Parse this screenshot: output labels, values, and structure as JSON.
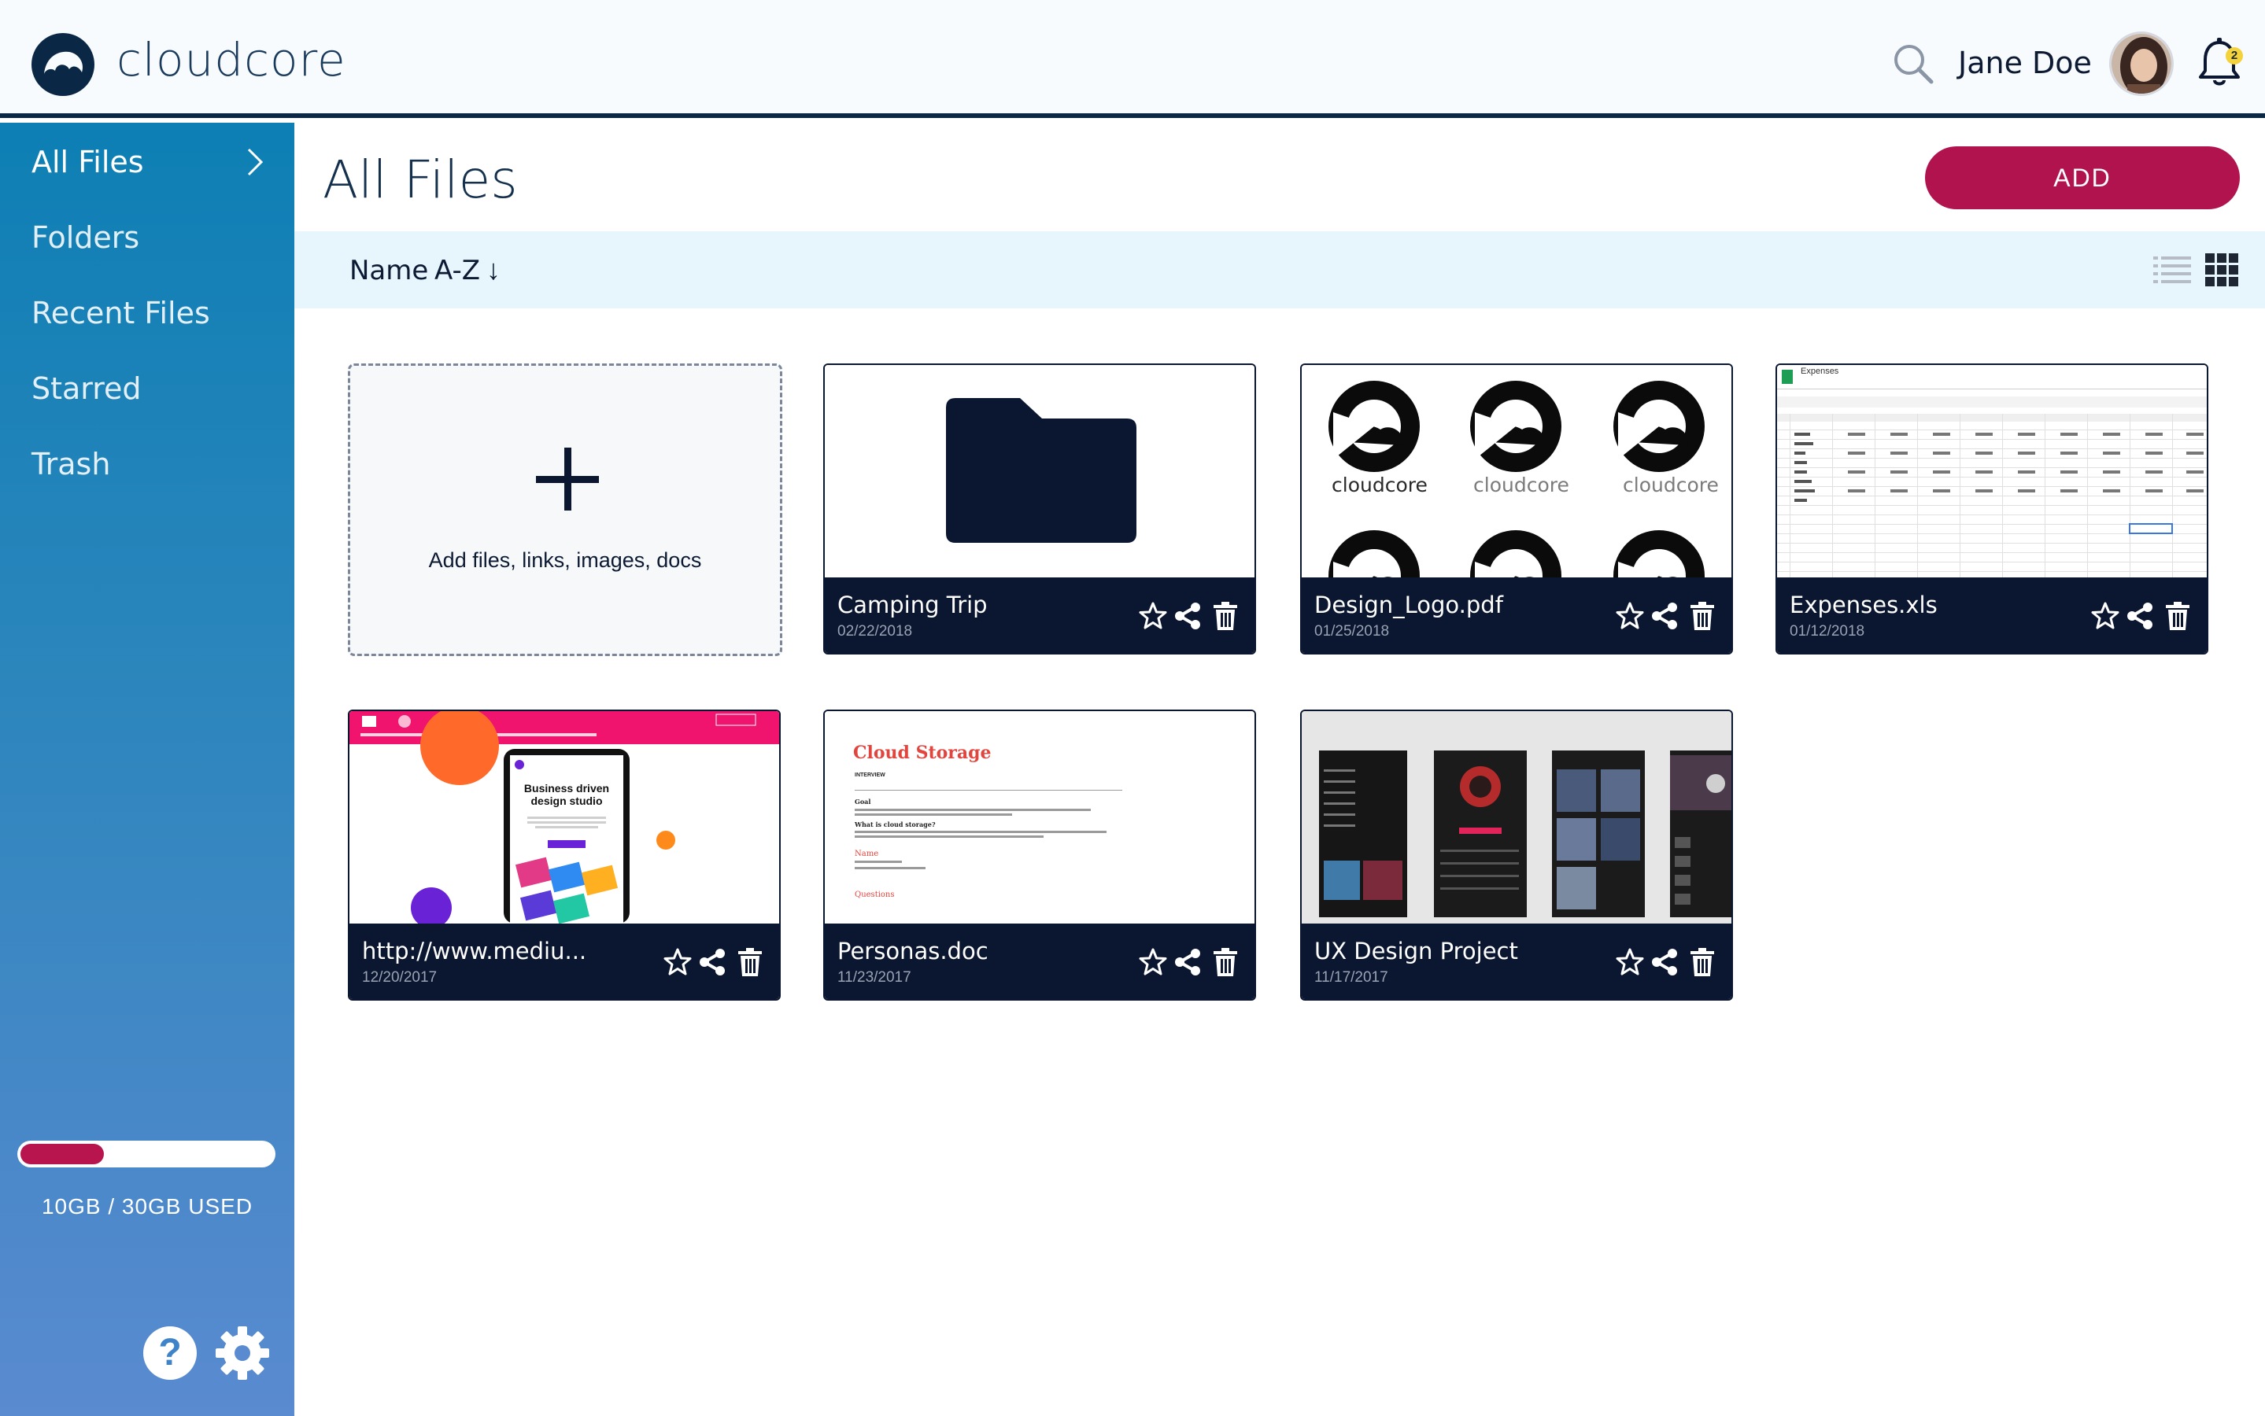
{
  "app": {
    "name": "cloudcore",
    "brand_color": "#0b2746",
    "accent_color": "#b0134e"
  },
  "header": {
    "user_name": "Jane Doe",
    "notification_count": "2"
  },
  "sidebar": {
    "items": [
      {
        "label": "All Files",
        "active": true
      },
      {
        "label": "Folders"
      },
      {
        "label": "Recent Files"
      },
      {
        "label": "Starred"
      },
      {
        "label": "Trash"
      }
    ],
    "storage_text": "10GB / 30GB USED",
    "storage_used_fraction": 0.33
  },
  "main": {
    "title": "All Files",
    "add_label": "ADD",
    "sort": {
      "label": "Name",
      "order": "A-Z",
      "arrow": "↓"
    },
    "add_tile_text": "Add files, links, images, docs"
  },
  "files": [
    {
      "name": "Camping Trip",
      "date": "02/22/2018",
      "type": "folder"
    },
    {
      "name": "Design_Logo.pdf",
      "date": "01/25/2018",
      "type": "pdf",
      "thumb_text": "cloudcore"
    },
    {
      "name": "Expenses.xls",
      "date": "01/12/2018",
      "type": "spreadsheet",
      "sheet_title": "Expenses"
    },
    {
      "name": "http://www.mediu...",
      "date": "12/20/2017",
      "type": "link",
      "thumb_headline": "Business driven design studio"
    },
    {
      "name": "Personas.doc",
      "date": "11/23/2017",
      "type": "doc",
      "doc_title": "Cloud Storage",
      "doc_subtitle": "INTERVIEW",
      "doc_heading_1": "Goal",
      "doc_heading_2": "What is cloud storage?",
      "doc_heading_3": "Name",
      "doc_heading_4": "Questions"
    },
    {
      "name": "UX Design Project",
      "date": "11/17/2017",
      "type": "image"
    }
  ]
}
